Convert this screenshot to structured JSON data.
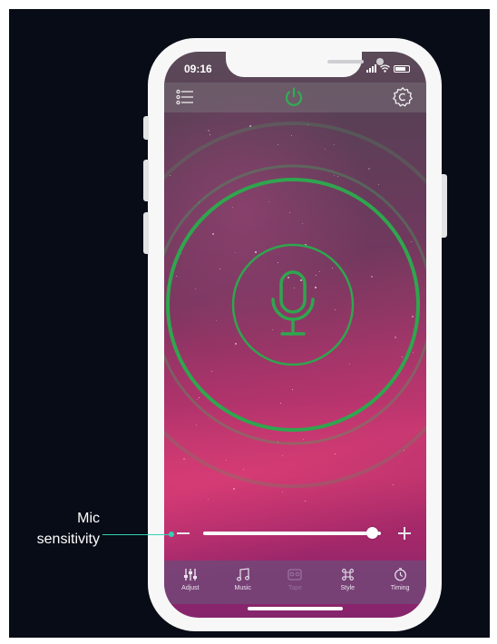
{
  "status_bar": {
    "time": "09:16"
  },
  "top_bar": {
    "menu_icon": "list-menu-icon",
    "power_icon": "power-icon",
    "settings_icon": "gear-icon"
  },
  "main": {
    "mic_icon": "microphone-icon"
  },
  "sensitivity_slider": {
    "value": 0.95
  },
  "callout": {
    "line1": "Mic",
    "line2": "sensitivity"
  },
  "tabs": [
    {
      "label": "Adjust",
      "icon": "sliders-icon",
      "active": false
    },
    {
      "label": "Music",
      "icon": "music-note-icon",
      "active": false
    },
    {
      "label": "Tape",
      "icon": "tape-icon",
      "active": true
    },
    {
      "label": "Style",
      "icon": "command-icon",
      "active": false
    },
    {
      "label": "Timing",
      "icon": "clock-icon",
      "active": false
    }
  ],
  "colors": {
    "accent_green": "#2fae52",
    "callout_teal": "#34d1b2",
    "background": "#070c16"
  }
}
